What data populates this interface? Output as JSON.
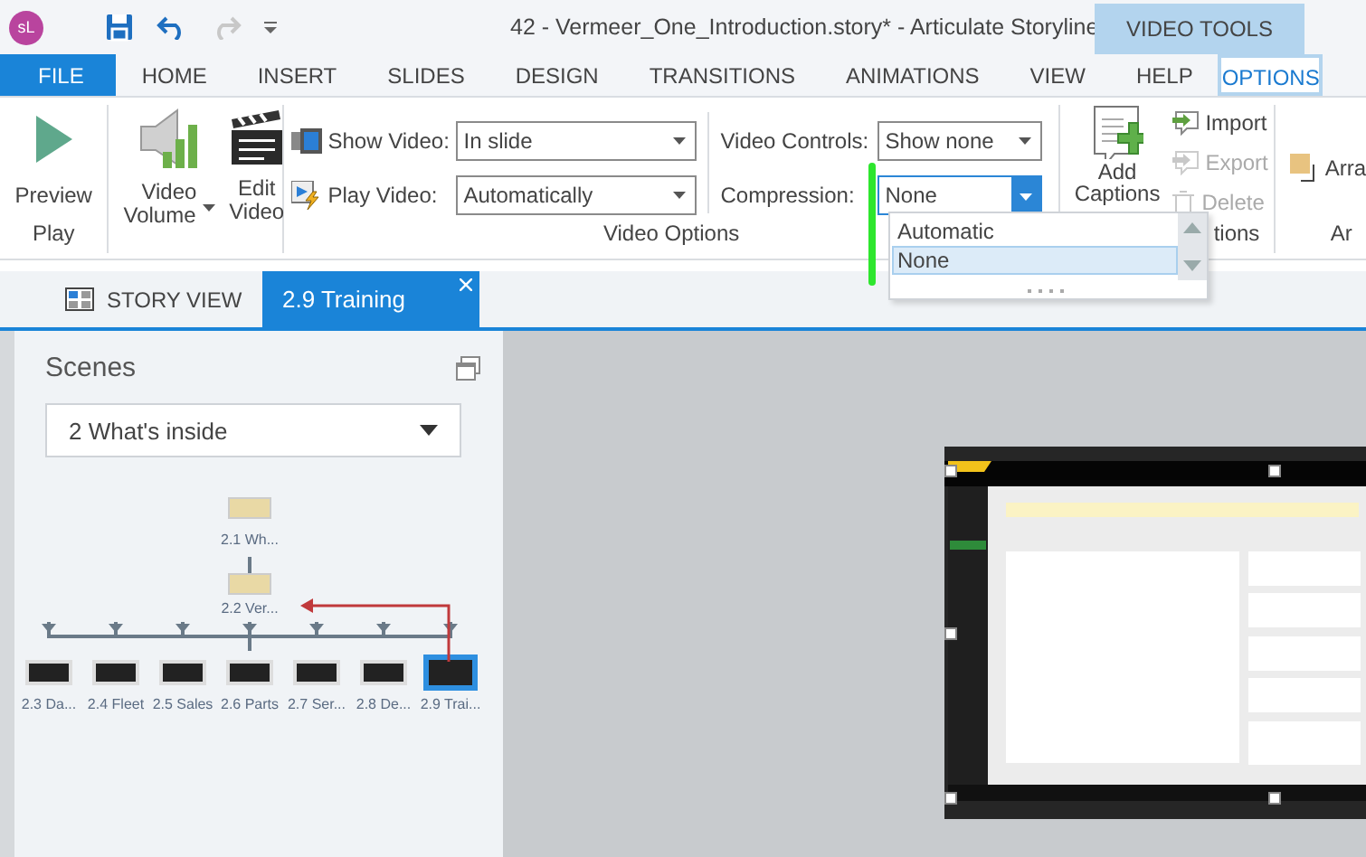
{
  "title_bar": {
    "app_initials": "sL",
    "title": "42 - Vermeer_One_Introduction.story* -  Articulate Storyline",
    "context_label": "VIDEO TOOLS"
  },
  "ribbon_tabs": [
    {
      "label": "FILE",
      "kind": "file",
      "selected": false
    },
    {
      "label": "HOME",
      "kind": "tab",
      "selected": false
    },
    {
      "label": "INSERT",
      "kind": "tab",
      "selected": false
    },
    {
      "label": "SLIDES",
      "kind": "tab",
      "selected": false
    },
    {
      "label": "DESIGN",
      "kind": "tab",
      "selected": false
    },
    {
      "label": "TRANSITIONS",
      "kind": "tab",
      "selected": false
    },
    {
      "label": "ANIMATIONS",
      "kind": "tab",
      "selected": false
    },
    {
      "label": "VIEW",
      "kind": "tab",
      "selected": false
    },
    {
      "label": "HELP",
      "kind": "tab",
      "selected": false
    },
    {
      "label": "OPTIONS",
      "kind": "context",
      "selected": true
    }
  ],
  "ribbon": {
    "play": {
      "button": "Preview",
      "group_label": "Play"
    },
    "media_buttons": [
      {
        "kind": "volume",
        "lines": [
          "Video",
          "Volume"
        ],
        "dropdown": true
      },
      {
        "kind": "edit",
        "lines": [
          "Edit",
          "Video"
        ],
        "dropdown": false
      }
    ],
    "video_options": {
      "group_label": "Video Options",
      "fields": [
        {
          "kind": "show",
          "label": "Show Video:",
          "value": "In slide",
          "focused": false
        },
        {
          "kind": "play",
          "label": "Play Video:",
          "value": "Automatically",
          "focused": false
        },
        {
          "kind": "plain",
          "label": "Video Controls:",
          "value": "Show none",
          "focused": false
        },
        {
          "kind": "plain",
          "label": "Compression:",
          "value": "None",
          "focused": true
        }
      ]
    },
    "compression_options": [
      {
        "label": "Automatic",
        "selected": false
      },
      {
        "label": "None",
        "selected": true
      }
    ],
    "captions": {
      "add_button": [
        "Add",
        "Captions"
      ],
      "group_label": "tions",
      "actions": [
        {
          "kind": "import",
          "label": "Import",
          "disabled": false
        },
        {
          "kind": "export",
          "label": "Export",
          "disabled": true
        },
        {
          "kind": "delete",
          "label": "Delete",
          "disabled": true
        }
      ]
    },
    "arrange": {
      "button": "Arra",
      "group_label": "Ar"
    }
  },
  "view_tabs": [
    {
      "kind": "story",
      "label": "STORY VIEW",
      "selected": false,
      "closable": false
    },
    {
      "kind": "slide",
      "label": "2.9 Training",
      "selected": true,
      "closable": true
    }
  ],
  "scenes_panel": {
    "title": "Scenes",
    "scene": "2 What's inside",
    "slides": [
      {
        "label": "2.1 Wh...",
        "selected": false,
        "children": [
          {
            "label": "2.2 Ver...",
            "selected": false,
            "children": [
              {
                "label": "2.3 Da...",
                "selected": false,
                "links_back": false
              },
              {
                "label": "2.4 Fleet",
                "selected": false,
                "links_back": false
              },
              {
                "label": "2.5 Sales",
                "selected": false,
                "links_back": false
              },
              {
                "label": "2.6 Parts",
                "selected": false,
                "links_back": false
              },
              {
                "label": "2.7 Ser...",
                "selected": false,
                "links_back": false
              },
              {
                "label": "2.8 De...",
                "selected": false,
                "links_back": false
              },
              {
                "label": "2.9 Trai...",
                "selected": true,
                "links_back": true
              }
            ]
          }
        ]
      }
    ]
  },
  "slide_stage": {
    "kind": "picture",
    "selected": true
  }
}
